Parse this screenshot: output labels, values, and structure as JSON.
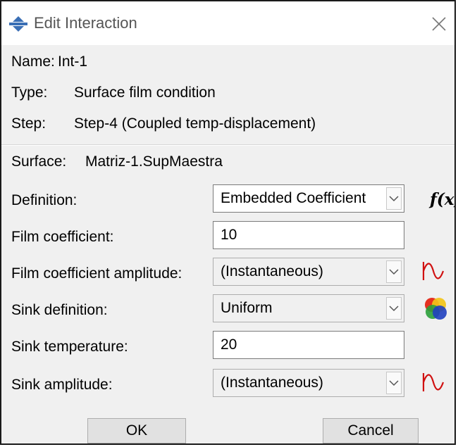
{
  "window": {
    "title": "Edit Interaction"
  },
  "info": {
    "name_label": "Name:",
    "name_value": "Int-1",
    "type_label": "Type:",
    "type_value": "Surface film condition",
    "step_label": "Step:",
    "step_value": "Step-4 (Coupled temp-displacement)"
  },
  "surface": {
    "label": "Surface:",
    "value": "Matriz-1.SupMaestra"
  },
  "form": {
    "definition": {
      "label": "Definition:",
      "value": "Embedded Coefficient",
      "fx_text": "f(x)"
    },
    "film_coefficient": {
      "label": "Film coefficient:",
      "value": "10"
    },
    "film_coefficient_amplitude": {
      "label": "Film coefficient amplitude:",
      "value": "(Instantaneous)"
    },
    "sink_definition": {
      "label": "Sink definition:",
      "value": "Uniform"
    },
    "sink_temperature": {
      "label": "Sink temperature:",
      "value": "20"
    },
    "sink_amplitude": {
      "label": "Sink amplitude:",
      "value": "(Instantaneous)"
    }
  },
  "buttons": {
    "ok": "OK",
    "cancel": "Cancel"
  },
  "icons": {
    "app": "abaqus-icon",
    "close": "close-icon",
    "amplitude": "amplitude-icon",
    "field": "analytical-field-icon",
    "dropdown": "chevron-down-icon"
  },
  "colors": {
    "amplitude_icon": "#d01010",
    "accent": "#1a6fc9"
  }
}
